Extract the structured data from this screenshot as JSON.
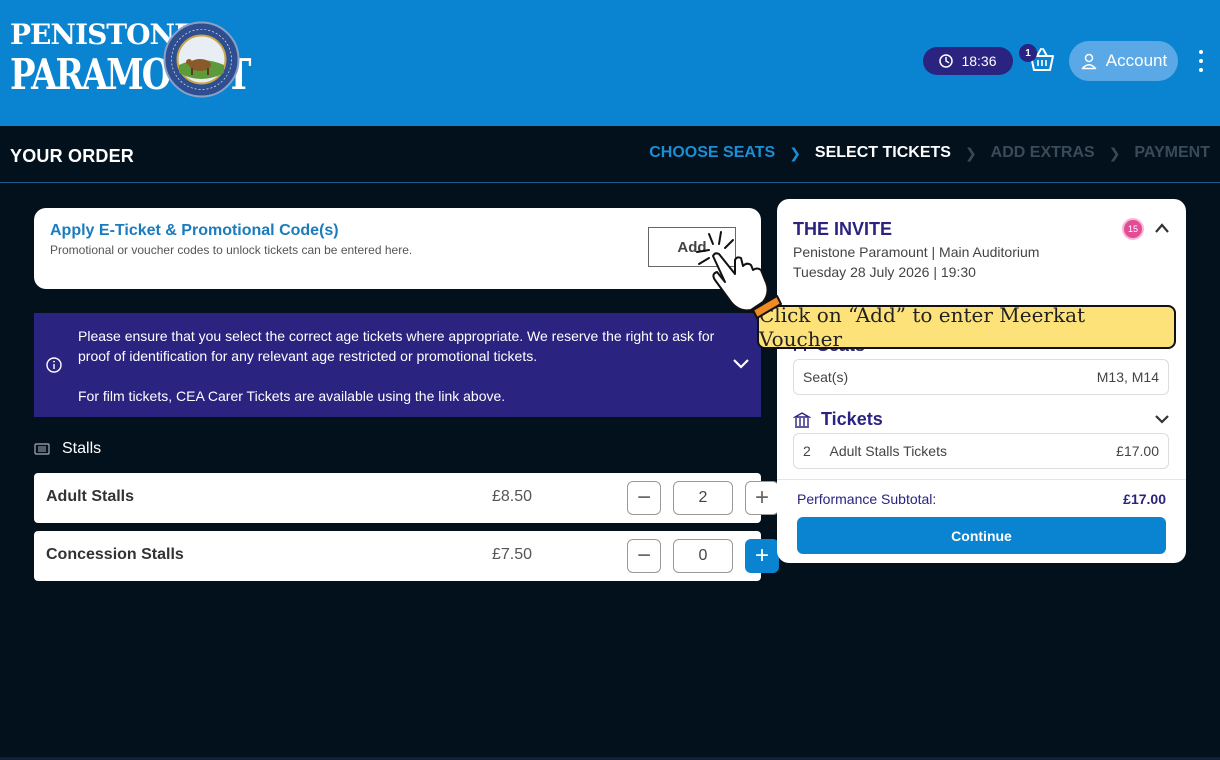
{
  "brand": {
    "name_line1": "PENISTONE",
    "name_line2": "PARAMOUNT",
    "seal_text": "PENISTONE TOWN COUNCIL",
    "icon": "council-seal-icon"
  },
  "header": {
    "timer": "18:36",
    "basket_count": "1",
    "account_label": "Account",
    "colors": {
      "topbar": "#0a84d0",
      "timer_bg": "#2a2380",
      "account_bg": "#5aa9e6"
    }
  },
  "order": {
    "title": "YOUR ORDER",
    "steps": [
      {
        "label": "CHOOSE SEATS",
        "state": "done"
      },
      {
        "label": "SELECT TICKETS",
        "state": "current"
      },
      {
        "label": "ADD EXTRAS",
        "state": "upcoming"
      },
      {
        "label": "PAYMENT",
        "state": "upcoming"
      }
    ]
  },
  "promo": {
    "title": "Apply E-Ticket & Promotional Code(s)",
    "subtitle": "Promotional or voucher codes to unlock tickets can be entered here.",
    "add_label": "Add"
  },
  "notice": {
    "line1": "Please ensure that you select the correct age tickets where appropriate. We reserve the right to ask for proof of identification for any relevant age restricted or promotional tickets.",
    "line2": "For film tickets, CEA Carer Tickets are available using the link above."
  },
  "stalls": {
    "heading": "Stalls",
    "tickets": [
      {
        "name": "Adult Stalls",
        "price": "£8.50",
        "qty": "2"
      },
      {
        "name": "Concession Stalls",
        "price": "£7.50",
        "qty": "0"
      }
    ]
  },
  "summary": {
    "title": "THE INVITE",
    "age_rating": "15",
    "venue": "Penistone Paramount | Main Auditorium",
    "datetime": "Tuesday 28 July 2026 | 19:30",
    "seats_heading": "Seats",
    "seats_label": "Seat(s)",
    "seats_value": "M13, M14",
    "tickets_heading": "Tickets",
    "ticket_qty": "2",
    "ticket_name": "Adult Stalls Tickets",
    "ticket_total": "£17.00",
    "subtotal_label": "Performance Subtotal:",
    "subtotal_value": "£17.00",
    "continue_label": "Continue"
  },
  "tutorial": {
    "callout": "Click on “Add” to enter Meerkat Voucher"
  }
}
